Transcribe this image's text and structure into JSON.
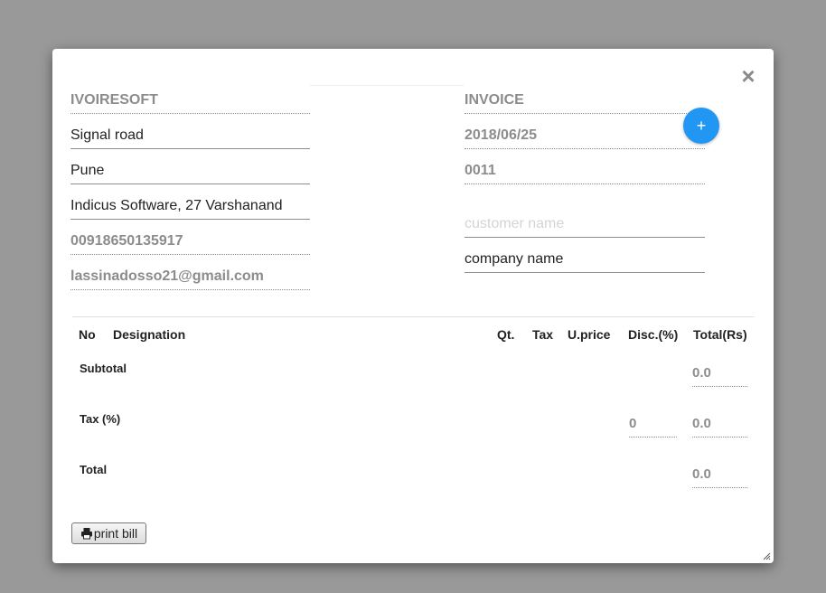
{
  "close_icon": "×",
  "seller": {
    "company": "IVOIRESOFT",
    "street": "Signal road",
    "city": "Pune",
    "address": "Indicus Software, 27 Varshanand",
    "phone": "00918650135917",
    "email": "lassinadosso21@gmail.com"
  },
  "invoice": {
    "title": "INVOICE",
    "date": "2018/06/25",
    "number": "0011",
    "customer_placeholder": "customer name",
    "company_value": "company name"
  },
  "add_button": "+",
  "table": {
    "headers": {
      "no": "No",
      "designation": "Designation",
      "qty": "Qt.",
      "tax": "Tax",
      "uprice": "U.price",
      "disc": "Disc.(%)",
      "total": "Total(Rs)"
    },
    "subtotal_label": "Subtotal",
    "subtotal_value": "0.0",
    "tax_label": "Tax (%)",
    "tax_percent": "0",
    "tax_value": "0.0",
    "total_label": "Total",
    "total_value": "0.0"
  },
  "print_button": "print bill",
  "icons": {
    "close": "close-icon",
    "print": "printer-icon",
    "resize": "resize-handle-icon"
  }
}
